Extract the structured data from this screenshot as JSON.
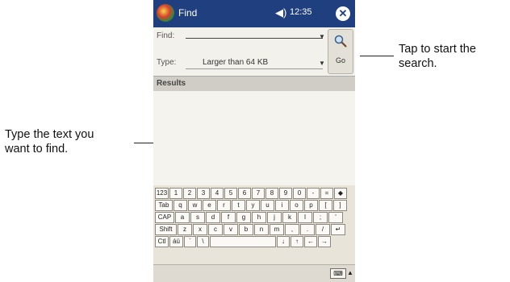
{
  "callouts": {
    "left_line1": "Type the text you",
    "left_line2": "want to find.",
    "right_line1": "Tap to start the",
    "right_line2": "search."
  },
  "titlebar": {
    "title": "Find",
    "time": "12:35",
    "speaker_icon": "speaker-icon",
    "close_icon": "close-icon",
    "close_glyph": "✕"
  },
  "form": {
    "find_label": "Find:",
    "find_value": "",
    "type_label": "Type:",
    "type_value": "Larger than 64 KB",
    "dropdown_glyph": "▼"
  },
  "go_button": {
    "label": "Go",
    "icon": "magnifier-icon"
  },
  "results": {
    "label": "Results"
  },
  "keyboard": {
    "rows": [
      [
        "123",
        "1",
        "2",
        "3",
        "4",
        "5",
        "6",
        "7",
        "8",
        "9",
        "0",
        "-",
        "=",
        "◆"
      ],
      [
        "Tab",
        "q",
        "w",
        "e",
        "r",
        "t",
        "y",
        "u",
        "i",
        "o",
        "p",
        "[",
        "]"
      ],
      [
        "CAP",
        "a",
        "s",
        "d",
        "f",
        "g",
        "h",
        "j",
        "k",
        "l",
        ";",
        "'"
      ],
      [
        "Shift",
        "z",
        "x",
        "c",
        "v",
        "b",
        "n",
        "m",
        ",",
        ".",
        "/",
        "↵"
      ],
      [
        "Ctl",
        "áü",
        "`",
        "\\",
        "",
        "↓",
        "↑",
        "←",
        "→"
      ]
    ]
  },
  "sip": {
    "icon": "keyboard-icon",
    "glyph": "⌨",
    "arrow": "▲"
  }
}
